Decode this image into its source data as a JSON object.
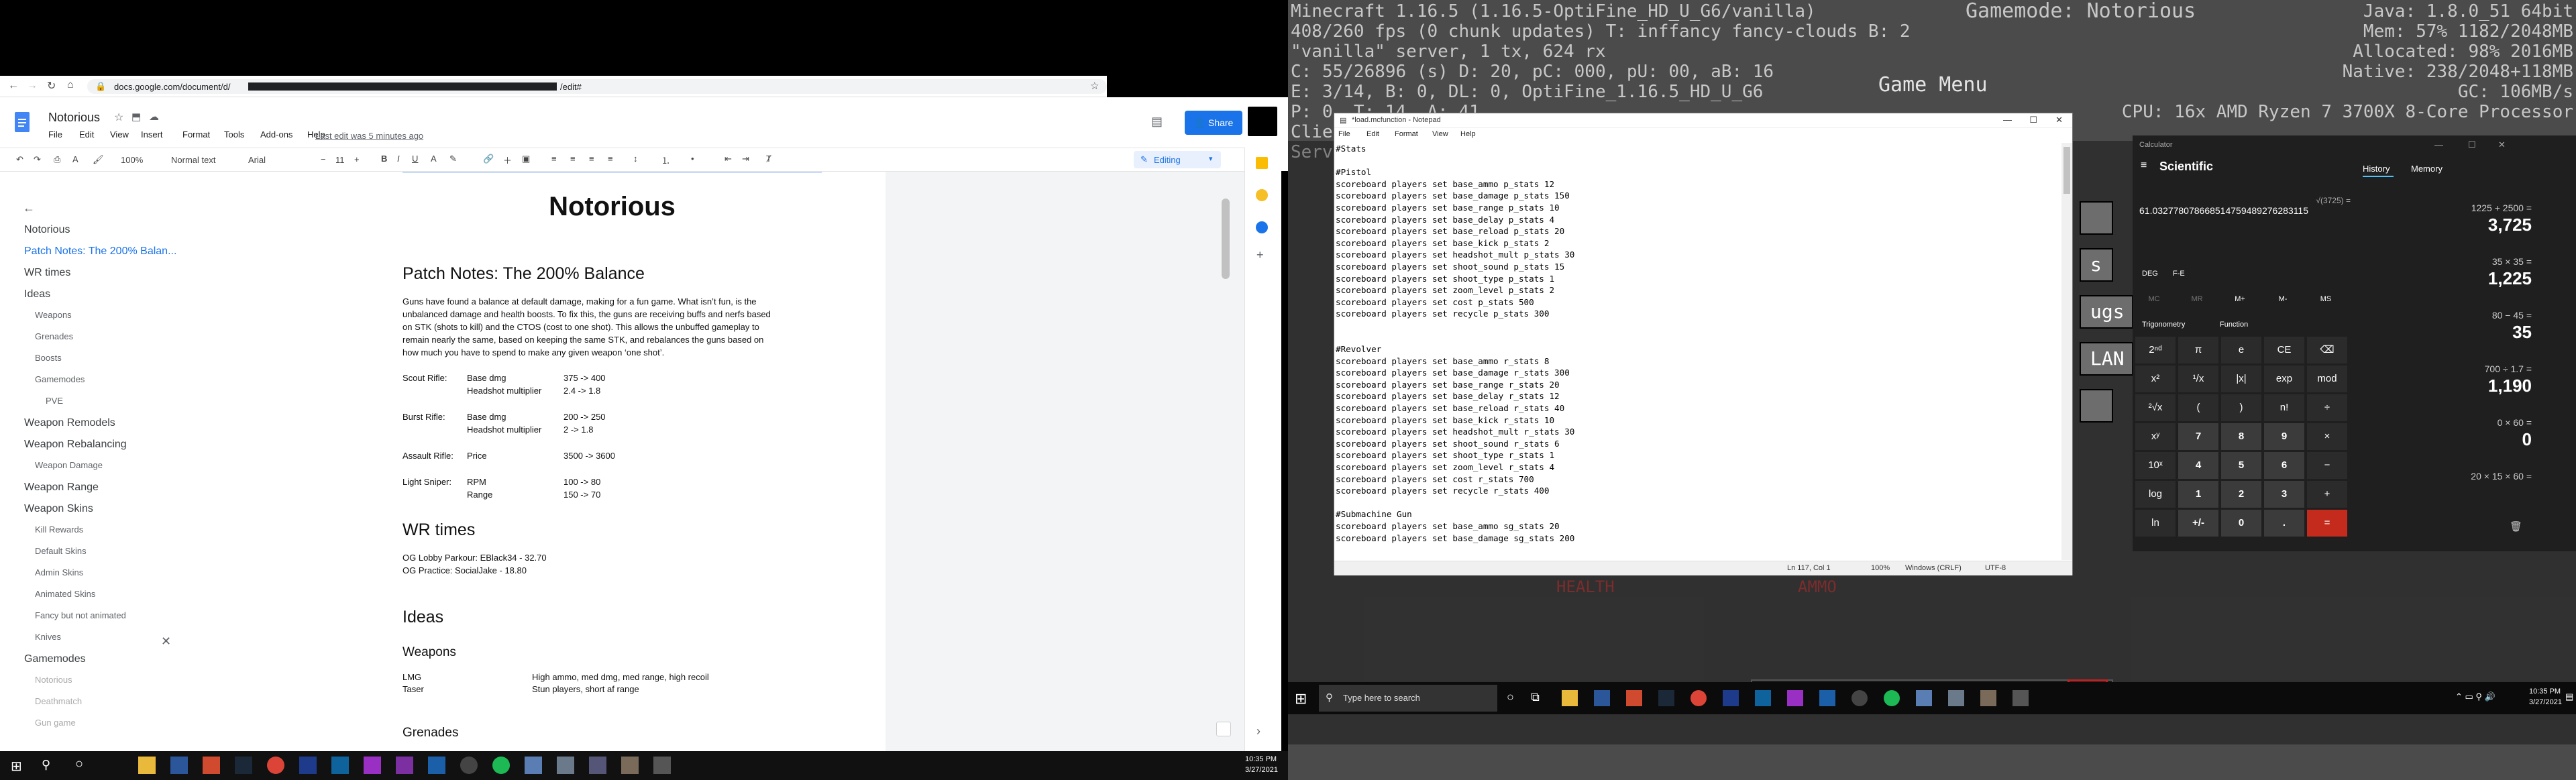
{
  "chrome": {
    "url_prefix": "docs.google.com/document/d/",
    "url_suffix": "/edit#"
  },
  "doc": {
    "title": "Notorious",
    "menus": [
      "File",
      "Edit",
      "View",
      "Insert",
      "Format",
      "Tools",
      "Add-ons",
      "Help"
    ],
    "last_edit": "Last edit was 5 minutes ago",
    "share": "Share",
    "zoom": "100%",
    "style": "Normal text",
    "font": "Arial",
    "size": "11",
    "mode": "Editing"
  },
  "outline": [
    {
      "label": "Notorious",
      "level": "h1",
      "state": "normal"
    },
    {
      "label": "Patch Notes: The 200% Balan...",
      "level": "h1",
      "state": "selected"
    },
    {
      "label": "WR times",
      "level": "h1",
      "state": "normal"
    },
    {
      "label": "Ideas",
      "level": "h1",
      "state": "normal"
    },
    {
      "label": "Weapons",
      "level": "sub",
      "state": "normal"
    },
    {
      "label": "Grenades",
      "level": "sub",
      "state": "normal"
    },
    {
      "label": "Boosts",
      "level": "sub",
      "state": "normal"
    },
    {
      "label": "Gamemodes",
      "level": "sub",
      "state": "normal"
    },
    {
      "label": "PVE",
      "level": "sub2",
      "state": "normal"
    },
    {
      "label": "Weapon Remodels",
      "level": "h1",
      "state": "normal"
    },
    {
      "label": "Weapon Rebalancing",
      "level": "h1",
      "state": "normal"
    },
    {
      "label": "Weapon Damage",
      "level": "sub",
      "state": "normal"
    },
    {
      "label": "Weapon Range",
      "level": "h1",
      "state": "normal"
    },
    {
      "label": "Weapon Skins",
      "level": "h1",
      "state": "normal"
    },
    {
      "label": "Kill Rewards",
      "level": "sub",
      "state": "normal"
    },
    {
      "label": "Default Skins",
      "level": "sub",
      "state": "normal"
    },
    {
      "label": "Admin Skins",
      "level": "sub",
      "state": "normal"
    },
    {
      "label": "Animated Skins",
      "level": "sub",
      "state": "normal"
    },
    {
      "label": "Fancy but not animated",
      "level": "sub",
      "state": "normal"
    },
    {
      "label": "Knives",
      "level": "sub",
      "state": "normal"
    },
    {
      "label": "Gamemodes",
      "level": "h1",
      "state": "normal"
    },
    {
      "label": "Notorious",
      "level": "sub",
      "state": "dim"
    },
    {
      "label": "Deathmatch",
      "level": "sub",
      "state": "dim"
    },
    {
      "label": "Gun game",
      "level": "sub",
      "state": "dim"
    }
  ],
  "page": {
    "title": "Notorious",
    "h_patch": "Patch Notes: The 200% Balance",
    "patch_body": [
      "Guns have found a balance at default damage, making for a fun game. What isn’t fun, is the",
      "unbalanced damage and health boosts. To fix this, the guns are receiving buffs and nerfs based",
      "on STK (shots to kill) and the CTOS (cost to one shot). This allows the unbuffed gameplay to",
      "remain nearly the same, based on keeping the same STK, and rebalances the guns based on",
      "how much you have to spend to make any given weapon ‘one shot’."
    ],
    "changes": [
      {
        "gun": "Scout Rifle:",
        "stat": "Base dmg",
        "val": "375 -> 400"
      },
      {
        "gun": "",
        "stat": "Headshot multiplier",
        "val": "2.4 -> 1.8"
      },
      {
        "gun": "Burst Rifle:",
        "stat": "Base dmg",
        "val": "200 -> 250"
      },
      {
        "gun": "",
        "stat": "Headshot multiplier",
        "val": "2 -> 1.8"
      },
      {
        "gun": "Assault Rifle:",
        "stat": "Price",
        "val": "3500 -> 3600"
      },
      {
        "gun": "Light Sniper:",
        "stat": "RPM",
        "val": "100 -> 80"
      },
      {
        "gun": "",
        "stat": "Range",
        "val": "150 -> 70"
      }
    ],
    "h_wr": "WR times",
    "wr": [
      "OG Lobby Parkour: EBlack34 - 32.70",
      "OG Practice: SocialJake - 18.80"
    ],
    "h_ideas": "Ideas",
    "h_weapons": "Weapons",
    "weapons": [
      {
        "name": "LMG",
        "desc": "High ammo, med dmg, med range, high recoil"
      },
      {
        "name": "Taser",
        "desc": "Stun players, short af range"
      }
    ],
    "h_grenades": "Grenades"
  },
  "taskbar_left": {
    "time": "10:35 PM",
    "date": "3/27/2021"
  },
  "minecraft": {
    "left": [
      "Minecraft 1.16.5 (1.16.5-OptiFine_HD_U_G6/vanilla)",
      "408/260 fps (0 chunk updates) T: inffancy fancy-clouds B: 2",
      "\"vanilla\" server, 1 tx, 624 rx",
      "C: 55/26896 (s) D: 20, pC: 000, pU: 00, aB: 16",
      "E: 3/14, B: 0, DL: 0, OptiFine_1.16.5_HD_U_G6",
      "P: 0. T: 14, A: 41",
      "Client Chunk Cache: 961, 577",
      "ServerChunkCache: 2419"
    ],
    "right": [
      "Java: 1.8.0_51 64bit",
      "Mem: 57% 1182/2048MB",
      "Allocated: 98% 2016MB",
      "Native: 238/2048+118MB",
      "GC: 106MB/s",
      "CPU: 16x AMD Ryzen 7 3700X 8-Core Processor"
    ],
    "gamemode": "Gamemode: Notorious",
    "menu_title": "Game Menu",
    "buttons": [
      "s",
      "ugs",
      "LAN",
      ""
    ],
    "bar_labels": [
      "HEALTH",
      "AMMO"
    ]
  },
  "notepad": {
    "title": "*load.mcfunction - Notepad",
    "menus": [
      "File",
      "Edit",
      "Format",
      "View",
      "Help"
    ],
    "lines": [
      "#Stats",
      "",
      "#Pistol",
      "scoreboard players set base_ammo p_stats 12",
      "scoreboard players set base_damage p_stats 150",
      "scoreboard players set base_range p_stats 10",
      "scoreboard players set base_delay p_stats 4",
      "scoreboard players set base_reload p_stats 20",
      "scoreboard players set base_kick p_stats 2",
      "scoreboard players set headshot_mult p_stats 30",
      "scoreboard players set shoot_sound p_stats 15",
      "scoreboard players set shoot_type p_stats 1",
      "scoreboard players set zoom_level p_stats 2",
      "scoreboard players set cost p_stats 500",
      "scoreboard players set recycle p_stats 300",
      "",
      "",
      "#Revolver",
      "scoreboard players set base_ammo r_stats 8",
      "scoreboard players set base_damage r_stats 300",
      "scoreboard players set base_range r_stats 20",
      "scoreboard players set base_delay r_stats 12",
      "scoreboard players set base_reload r_stats 40",
      "scoreboard players set base_kick r_stats 10",
      "scoreboard players set headshot_mult r_stats 30",
      "scoreboard players set shoot_sound r_stats 6",
      "scoreboard players set shoot_type r_stats 1",
      "scoreboard players set zoom_level r_stats 4",
      "scoreboard players set cost r_stats 700",
      "scoreboard players set recycle r_stats 400",
      "",
      "#Submachine Gun",
      "scoreboard players set base_ammo sg_stats 20",
      "scoreboard players set base_damage sg_stats 200"
    ],
    "status": {
      "pos": "Ln 117, Col 1",
      "zoom": "100%",
      "eol": "Windows (CRLF)",
      "enc": "UTF-8"
    }
  },
  "calc": {
    "app": "Calculator",
    "mode": "Scientific",
    "expr": "√(3725) =",
    "result": "61.032778078668514759489276283115",
    "tabs": [
      "History",
      "Memory"
    ],
    "deg": "DEG",
    "fe": "F-E",
    "mem": [
      "MC",
      "MR",
      "M+",
      "M-",
      "MS"
    ],
    "trig": "Trigonometry",
    "func": "Function",
    "keys": [
      [
        "2ⁿᵈ",
        "π",
        "e",
        "CE",
        "⌫"
      ],
      [
        "x²",
        "¹/x",
        "|x|",
        "exp",
        "mod"
      ],
      [
        "²√x",
        "(",
        ")",
        "n!",
        "÷"
      ],
      [
        "xʸ",
        "7",
        "8",
        "9",
        "×"
      ],
      [
        "10ˣ",
        "4",
        "5",
        "6",
        "−"
      ],
      [
        "log",
        "1",
        "2",
        "3",
        "+"
      ],
      [
        "ln",
        "+/-",
        "0",
        ".",
        "="
      ]
    ],
    "history": [
      {
        "expr": "1225 + 2500 =",
        "res": "3,725"
      },
      {
        "expr": "35 × 35 =",
        "res": "1,225"
      },
      {
        "expr": "80 − 45 =",
        "res": "35"
      },
      {
        "expr": "700 ÷ 1.7 =",
        "res": "1,190"
      },
      {
        "expr": "0 × 60 =",
        "res": "0"
      },
      {
        "expr": "20 × 15 × 60 =",
        "res": ""
      }
    ]
  },
  "taskbar_right": {
    "search": "Type here to search",
    "time": "10:35 PM",
    "date": "3/27/2021"
  }
}
